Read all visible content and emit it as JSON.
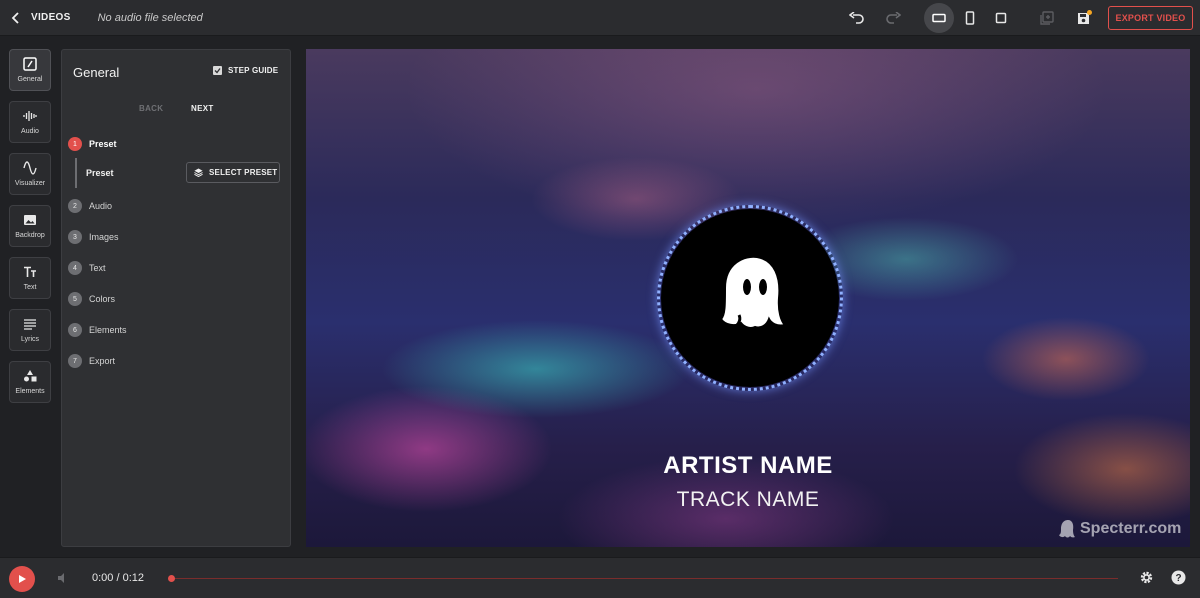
{
  "topbar": {
    "back_label": "VIDEOS",
    "file_status": "No audio file selected",
    "export_label": "EXPORT VIDEO"
  },
  "rail": {
    "items": [
      {
        "label": "General",
        "icon": "general-icon"
      },
      {
        "label": "Audio",
        "icon": "audio-wave-icon"
      },
      {
        "label": "Visualizer",
        "icon": "wave-icon"
      },
      {
        "label": "Backdrop",
        "icon": "image-icon"
      },
      {
        "label": "Text",
        "icon": "text-icon"
      },
      {
        "label": "Lyrics",
        "icon": "lines-icon"
      },
      {
        "label": "Elements",
        "icon": "shapes-icon"
      }
    ]
  },
  "panel": {
    "title": "General",
    "step_guide_label": "STEP GUIDE",
    "step_guide_checked": true,
    "nav_back": "BACK",
    "nav_next": "NEXT",
    "preset_sub_label": "Preset",
    "select_preset_label": "SELECT PRESET",
    "steps": [
      {
        "num": "1",
        "label": "Preset"
      },
      {
        "num": "2",
        "label": "Audio"
      },
      {
        "num": "3",
        "label": "Images"
      },
      {
        "num": "4",
        "label": "Text"
      },
      {
        "num": "5",
        "label": "Colors"
      },
      {
        "num": "6",
        "label": "Elements"
      },
      {
        "num": "7",
        "label": "Export"
      }
    ]
  },
  "canvas": {
    "artist": "ARTIST NAME",
    "track": "TRACK NAME",
    "watermark": "Specterr.com"
  },
  "player": {
    "time": "0:00 / 0:12",
    "progress": 0
  },
  "colors": {
    "accent": "#e2504c",
    "background": "#202124",
    "panel": "#2f3033"
  }
}
